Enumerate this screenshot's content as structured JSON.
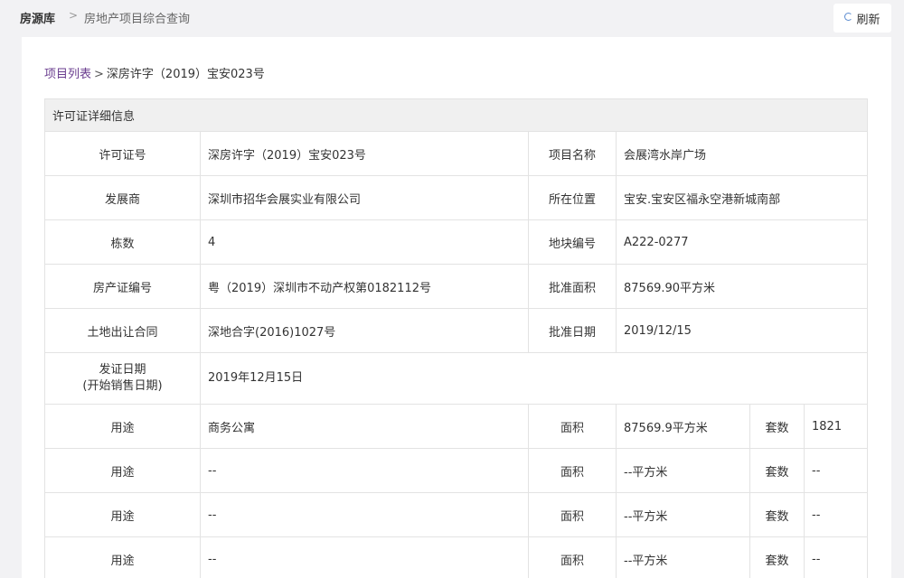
{
  "breadcrumb": {
    "root": "房源库",
    "separator": ">",
    "current": "房地产项目综合查询"
  },
  "refresh": {
    "label": "刷新",
    "icon": "refresh-icon"
  },
  "subcrumb": {
    "link": "项目列表",
    "separator": ">",
    "current": "深房许字（2019）宝安023号"
  },
  "section_title": "许可证详细信息",
  "fields": {
    "permit_no": {
      "label": "许可证号",
      "value": "深房许字（2019）宝安023号"
    },
    "project_name": {
      "label": "项目名称",
      "value": "会展湾水岸广场"
    },
    "developer": {
      "label": "发展商",
      "value": "深圳市招华会展实业有限公司"
    },
    "location": {
      "label": "所在位置",
      "value": "宝安.宝安区福永空港新城南部"
    },
    "buildings": {
      "label": "栋数",
      "value": "4"
    },
    "plot_no": {
      "label": "地块编号",
      "value": "A222-0277"
    },
    "property_cert": {
      "label": "房产证编号",
      "value": "粤（2019）深圳市不动产权第0182112号"
    },
    "approved_area": {
      "label": "批准面积",
      "value": "87569.90平方米"
    },
    "land_contract": {
      "label": "土地出让合同",
      "value": "深地合字(2016)1027号"
    },
    "approved_date": {
      "label": "批准日期",
      "value": "2019/12/15"
    },
    "issue_date": {
      "label_line1": "发证日期",
      "label_line2": "(开始销售日期)",
      "value": "2019年12月15日"
    }
  },
  "usage_rows": [
    {
      "usage_label": "用途",
      "usage": "商务公寓",
      "area_label": "面积",
      "area": "87569.9平方米",
      "units_label": "套数",
      "units": "1821"
    },
    {
      "usage_label": "用途",
      "usage": "--",
      "area_label": "面积",
      "area": "--平方米",
      "units_label": "套数",
      "units": "--"
    },
    {
      "usage_label": "用途",
      "usage": "--",
      "area_label": "面积",
      "area": "--平方米",
      "units_label": "套数",
      "units": "--"
    },
    {
      "usage_label": "用途",
      "usage": "--",
      "area_label": "面积",
      "area": "--平方米",
      "units_label": "套数",
      "units": "--"
    }
  ]
}
